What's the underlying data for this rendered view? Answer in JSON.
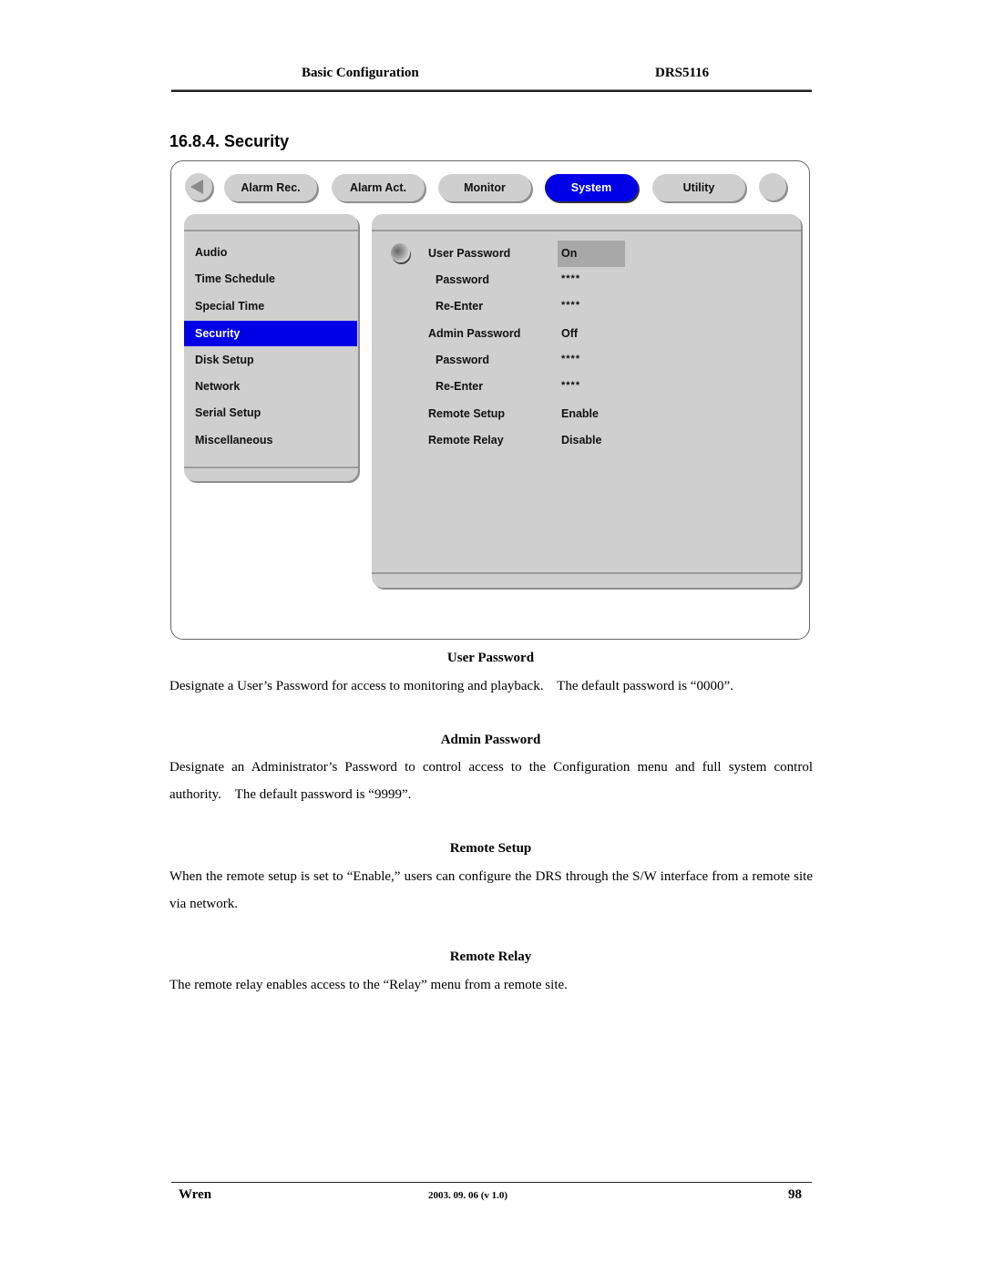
{
  "header": {
    "title": "Basic Configuration",
    "model": "DRS5116"
  },
  "section": {
    "title": "16.8.4. Security"
  },
  "ui": {
    "nav": {
      "back_icon": "left-triangle-icon",
      "tabs": [
        {
          "label": "Alarm Rec.",
          "active": false
        },
        {
          "label": "Alarm Act.",
          "active": false
        },
        {
          "label": "Monitor",
          "active": false
        },
        {
          "label": "System",
          "active": true
        },
        {
          "label": "Utility",
          "active": false
        }
      ],
      "active_color": "#0000E6"
    },
    "menu": {
      "items": [
        {
          "label": "Audio",
          "selected": false
        },
        {
          "label": "Time Schedule",
          "selected": false
        },
        {
          "label": "Special Time",
          "selected": false
        },
        {
          "label": "Security",
          "selected": true
        },
        {
          "label": "Disk Setup",
          "selected": false
        },
        {
          "label": "Network",
          "selected": false
        },
        {
          "label": "Serial Setup",
          "selected": false
        },
        {
          "label": "Miscellaneous",
          "selected": false
        }
      ],
      "selected_color": "#0000E6"
    },
    "settings": [
      {
        "label": "User Password",
        "value": "On",
        "focused": true
      },
      {
        "label": "Password",
        "value": "****"
      },
      {
        "label": "Re-Enter",
        "value": "****"
      },
      {
        "label": "Admin Password",
        "value": "Off"
      },
      {
        "label": "Password",
        "value": "****"
      },
      {
        "label": "Re-Enter",
        "value": "****"
      },
      {
        "label": "Remote Setup",
        "value": "Enable"
      },
      {
        "label": "Remote Relay",
        "value": "Disable"
      }
    ]
  },
  "descriptions": [
    {
      "heading": "User Password",
      "text": "Designate a User’s Password for access to monitoring and playback.    The default password is “0000”."
    },
    {
      "heading": "Admin Password",
      "text": "Designate an Administrator’s Password to control access to the Configuration menu and full system control authority.    The default password is “9999”."
    },
    {
      "heading": "Remote Setup",
      "text": "When the remote setup is set to “Enable,” users can configure the DRS through the S/W interface from a remote site via network."
    },
    {
      "heading": "Remote Relay",
      "text": "The remote relay enables access to the “Relay” menu from a remote site."
    }
  ],
  "footer": {
    "left": "Wren",
    "center": "2003. 09. 06 (v 1.0)",
    "page": "98"
  }
}
